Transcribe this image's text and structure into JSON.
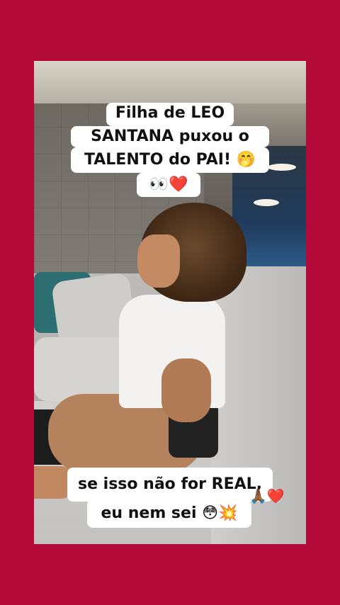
{
  "caption_top": {
    "line1": "Filha de LEO",
    "line2": "SANTANA puxou o",
    "line3": "TALENTO do PAI! 🤭",
    "line4": "👀❤️"
  },
  "caption_bottom": {
    "line1": "se isso não for REAL,",
    "line2": "eu nem sei 😳💥"
  },
  "floating_emoji": "🙏🏾❤️",
  "colors": {
    "background": "#b30a3a",
    "caption_bg": "#ffffff"
  }
}
